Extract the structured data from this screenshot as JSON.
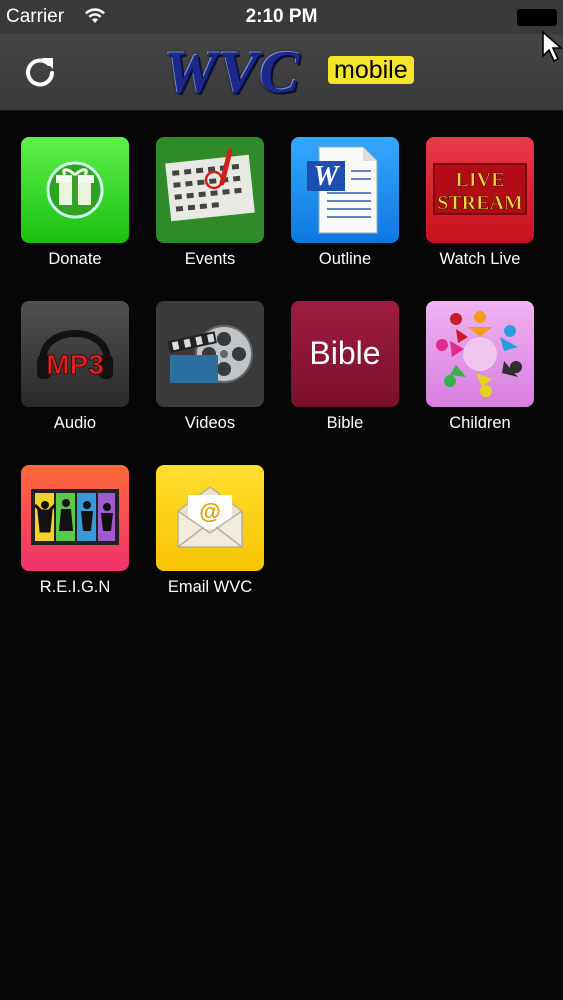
{
  "status_bar": {
    "carrier": "Carrier",
    "time": "2:10 PM"
  },
  "nav": {
    "logo_main": "WVC",
    "logo_sub": "mobile"
  },
  "tiles": [
    {
      "label": "Donate",
      "icon": "gift-icon",
      "color": "#33d81e"
    },
    {
      "label": "Events",
      "icon": "calendar-icon",
      "color": "#2f8a2a"
    },
    {
      "label": "Outline",
      "icon": "word-document-icon",
      "color": "#1a8ff0"
    },
    {
      "label": "Watch Live",
      "icon": "live-stream-icon",
      "color": "#e2202a"
    },
    {
      "label": "Audio",
      "icon": "mp3-headphones-icon",
      "color": "#3b3b3b"
    },
    {
      "label": "Videos",
      "icon": "film-reel-icon",
      "color": "#3a3a3a"
    },
    {
      "label": "Bible",
      "icon": "bible-icon",
      "color": "#8c1535"
    },
    {
      "label": "Children",
      "icon": "children-circle-icon",
      "color": "#e9a0ea"
    },
    {
      "label": "R.E.I.G.N",
      "icon": "dancers-icon",
      "color": "#f2426a"
    },
    {
      "label": "Email WVC",
      "icon": "email-envelope-icon",
      "color": "#ffd11a"
    }
  ],
  "icon_text": {
    "live_line1": "LIVE",
    "live_line2": "STREAM",
    "bible": "Bible",
    "mp3": "MP3",
    "email_at": "@",
    "word_w": "W"
  }
}
